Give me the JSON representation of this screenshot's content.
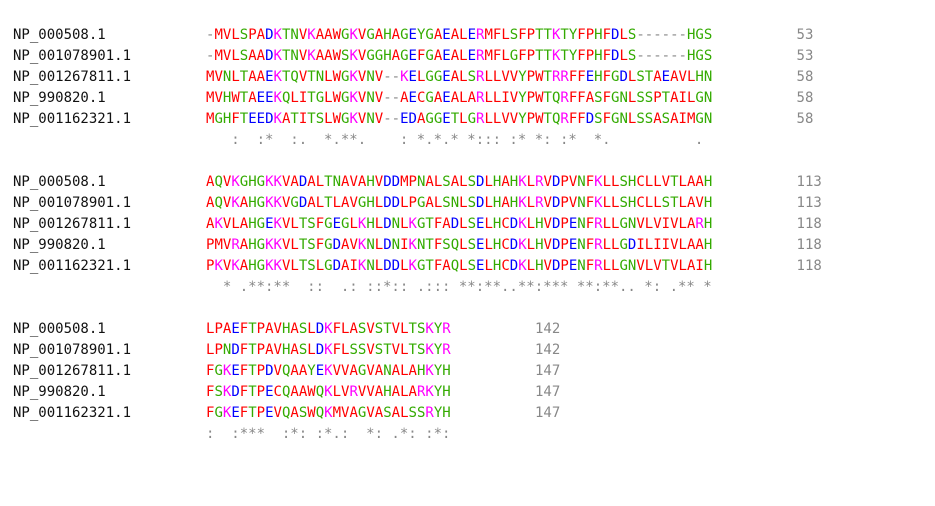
{
  "alignment": {
    "blocks": [
      {
        "block_id": 1,
        "rows": [
          {
            "name": "NP_000508.1",
            "seq": "-MVLSPADKTNVKAAWGKVGAHAGEYGAEALERMFLSFPTTKTYFPHFDLS------HGS",
            "count": "53"
          },
          {
            "name": "NP_001078901.1",
            "seq": "-MVLSAADKTNVKAAWSKVGGHAGEFGAEALERMFLGFPTTKTYFPHFDLS------HGS",
            "count": "53"
          },
          {
            "name": "NP_001267811.1",
            "seq": "MVNLTAAEKTQVTNLWGKVNV--KELGGEALSRLLVVYPWTRRFFEHFGDLSTAEAVLHN",
            "count": "58"
          },
          {
            "name": "NP_990820.1",
            "seq": "MVHWTAEEKQLITGLWGKVNV--AECGAEALARLLIVYPWTQRFFASFGNLSSPTAILGN",
            "count": "58"
          },
          {
            "name": "NP_001162321.1",
            "seq": "MGHFTEEDKATITSLWGKVNV--EDAGGETLGRLLVVYPWTQRFFDSFGNLSSASAIMGN",
            "count": "58"
          }
        ],
        "consensus": "   :  :*  :.  *.**.    : *.*.* *::: :* *: :*  *.          ."
      },
      {
        "block_id": 2,
        "rows": [
          {
            "name": "NP_000508.1",
            "seq": "AQVKGHGKKVADALTNAVAHVDDMPNALSALSDLHAHKLRVDPVNFKLLSHCLLVTLAAH",
            "count": "113"
          },
          {
            "name": "NP_001078901.1",
            "seq": "AQVKAHGKKVGDALTLAVGHLDDLPGALSNLSDLHAHKLRVDPVNFKLLSHCLLSTLAVH",
            "count": "113"
          },
          {
            "name": "NP_001267811.1",
            "seq": "AKVLAHGEKVLTSFGEGLKHLDNLKGTFADLSELHCDKLHVDPENFRLLGNVLVIVLARH",
            "count": "118"
          },
          {
            "name": "NP_990820.1",
            "seq": "PMVRAHGKKVLTSFGDAVKNLDNIKNTFSQLSELHCDKLHVDPENFRLLGDILIIVLAAH",
            "count": "118"
          },
          {
            "name": "NP_001162321.1",
            "seq": "PKVKAHGKKVLTSLGDAIKNLDDLKGTFAQLSELHCDKLHVDPENFRLLGNVLVTVLAIH",
            "count": "118"
          }
        ],
        "consensus": "  * .**:**  ::  .: ::*:: .::: **:**..**:*** **:**.. *: .** *"
      },
      {
        "block_id": 3,
        "rows": [
          {
            "name": "NP_000508.1",
            "seq": "LPAEFTPAVHASLDKFLASVSTVLTSKYR",
            "count": "142"
          },
          {
            "name": "NP_001078901.1",
            "seq": "LPNDFTPAVHASLDKFLSSVSTVLTSKYR",
            "count": "142"
          },
          {
            "name": "NP_001267811.1",
            "seq": "FGKEFTPDVQAAYEKVVAGVANALAHKYH",
            "count": "147"
          },
          {
            "name": "NP_990820.1",
            "seq": "FSKDFTPECQAAWQKLVRVVAHALARKYH",
            "count": "147"
          },
          {
            "name": "NP_001162321.1",
            "seq": "FGKEFTPEVQASWQKMVAGVASALSSRYH",
            "count": "147"
          }
        ],
        "consensus": ":  :***  :*: :*.:  *: .*: :*:"
      }
    ],
    "colors": {
      "small_hydrophobic": "#ff0000",
      "acidic": "#0000ff",
      "basic": "#ff00ff",
      "hydroxyl_amine": "#33aa00",
      "gap_and_counts": "#888888",
      "names": "#111111"
    }
  }
}
